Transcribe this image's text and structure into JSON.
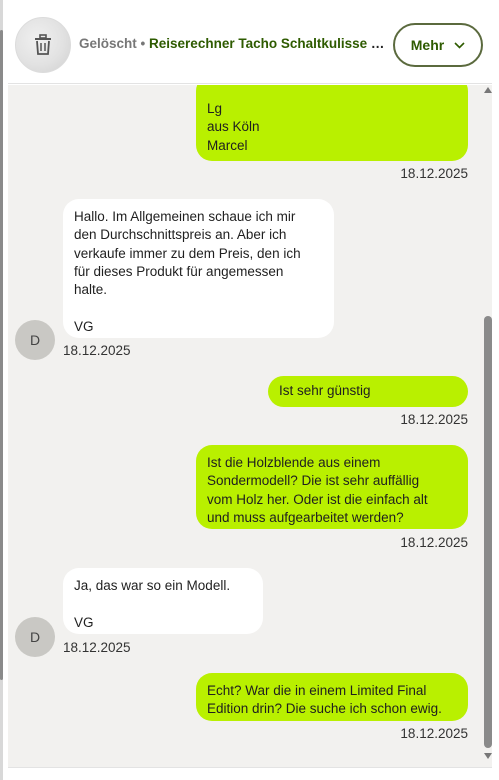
{
  "header": {
    "deleted_label": "Gelöscht",
    "separator": "•",
    "item_title": "Reiserechner Tacho Schaltkulisse Holzblende",
    "more_label": "Mehr"
  },
  "messages": [
    {
      "direction": "out",
      "text": "Lg\naus Köln\nMarcel",
      "date": "18.12.2025"
    },
    {
      "direction": "in",
      "text": "Hallo. Im Allgemeinen schaue ich mir\nden Durchschnittspreis an. Aber ich\nverkaufe immer zu dem Preis, den ich\nfür dieses Produkt für angemessen\nhalte.\n\nVG",
      "date": "18.12.2025",
      "avatar": "D"
    },
    {
      "direction": "out",
      "text": "Ist sehr günstig",
      "date": "18.12.2025"
    },
    {
      "direction": "out",
      "text": "Ist die Holzblende aus einem\nSondermodell? Die ist sehr auffällig\nvom Holz her. Oder ist die einfach alt\nund muss aufgearbeitet werden?",
      "date": "18.12.2025"
    },
    {
      "direction": "in",
      "text": "Ja, das war so ein Modell.\n\nVG",
      "date": "18.12.2025",
      "avatar": "D"
    },
    {
      "direction": "out",
      "text": "Echt? War die in einem Limited Final\nEdition drin? Die suche ich schon ewig.",
      "date": "18.12.2025"
    }
  ],
  "icons": {
    "header_avatar": "trash-icon",
    "more_chevron": "chevron-down-icon"
  },
  "colors": {
    "outgoing_bubble": "#b9f000",
    "incoming_bubble": "#ffffff",
    "chat_background": "#f2f1ef",
    "accent_text": "#2e5b00"
  }
}
